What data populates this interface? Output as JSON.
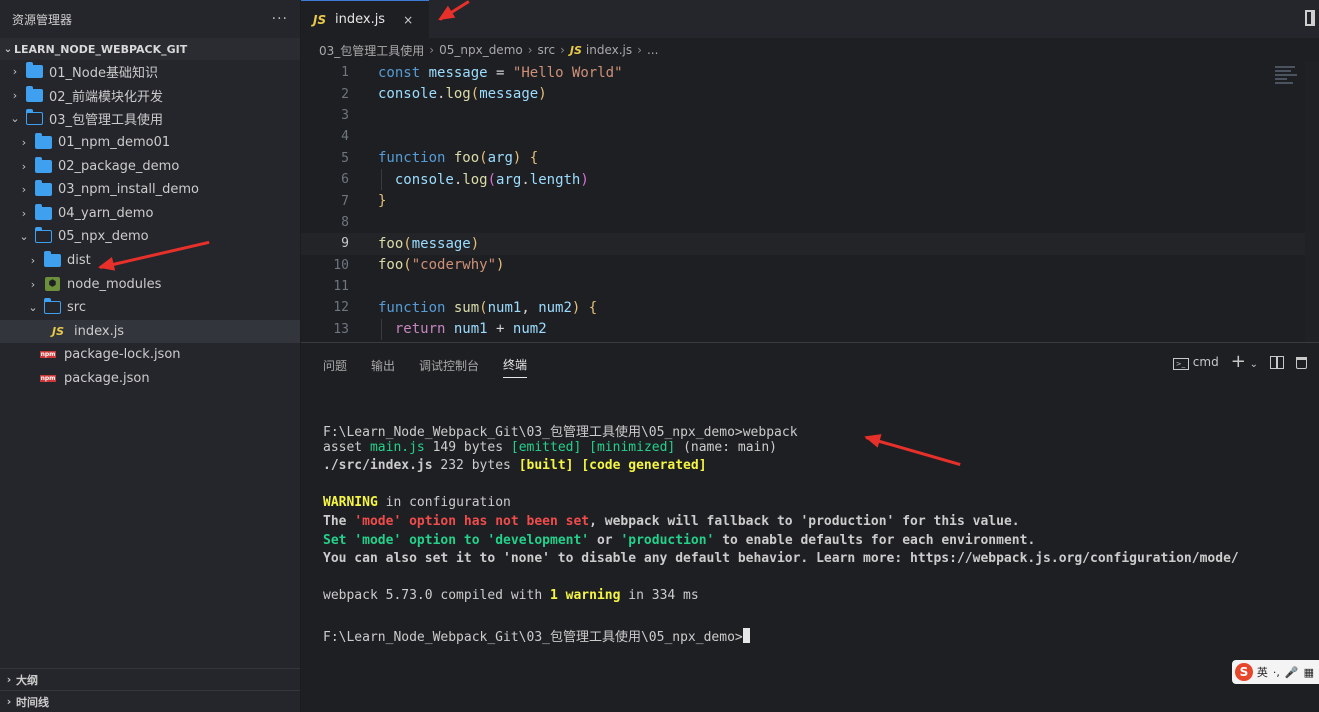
{
  "sidebar": {
    "title": "资源管理器",
    "more": "···",
    "root": "LEARN_NODE_WEBPACK_GIT",
    "items": [
      {
        "label": "01_Node基础知识"
      },
      {
        "label": "02_前端模块化开发"
      },
      {
        "label": "03_包管理工具使用"
      },
      {
        "label": "01_npm_demo01"
      },
      {
        "label": "02_package_demo"
      },
      {
        "label": "03_npm_install_demo"
      },
      {
        "label": "04_yarn_demo"
      },
      {
        "label": "05_npx_demo"
      },
      {
        "label": "dist"
      },
      {
        "label": "node_modules"
      },
      {
        "label": "src"
      },
      {
        "label": "index.js"
      },
      {
        "label": "package-lock.json"
      },
      {
        "label": "package.json"
      }
    ],
    "bottom_sections": [
      "大纲",
      "时间线"
    ]
  },
  "editor": {
    "tab": {
      "icon_text": "JS",
      "label": "index.js",
      "close": "×"
    },
    "breadcrumb": {
      "parts": [
        "03_包管理工具使用",
        "05_npx_demo",
        "src"
      ],
      "file_icon": "JS",
      "file": "index.js",
      "tail": "..."
    },
    "line_numbers": [
      "1",
      "2",
      "3",
      "4",
      "5",
      "6",
      "7",
      "8",
      "9",
      "10",
      "11",
      "12",
      "13"
    ],
    "code": {
      "l1": [
        "const",
        "message",
        "=",
        "\"Hello World\""
      ],
      "l2": [
        "console",
        ".",
        "log",
        "(",
        "message",
        ")"
      ],
      "l5": [
        "function",
        "foo",
        "(",
        "arg",
        ")",
        "{"
      ],
      "l6": [
        "console",
        ".",
        "log",
        "(",
        "arg",
        ".",
        "length",
        ")"
      ],
      "l7": [
        "}"
      ],
      "l9": [
        "foo",
        "(",
        "message",
        ")"
      ],
      "l10": [
        "foo",
        "(",
        "\"coderwhy\"",
        ")"
      ],
      "l12": [
        "function",
        "sum",
        "(",
        "num1",
        ",",
        "num2",
        ")",
        "{"
      ],
      "l13": [
        "return",
        "num1",
        "+",
        "num2"
      ]
    }
  },
  "panel": {
    "tabs": [
      "问题",
      "输出",
      "调试控制台",
      "终端"
    ],
    "shell": "cmd",
    "terminal": {
      "prompt1": "F:\\Learn_Node_Webpack_Git\\03_包管理工具使用\\05_npx_demo>",
      "cmd1": "webpack",
      "asset": "asset",
      "asset_name": "main.js",
      "asset_size": "149 bytes",
      "emitted": "[emitted]",
      "minimized": "[minimized]",
      "asset_tail": "(name: main)",
      "module": "./src/index.js",
      "module_size": "232 bytes",
      "built": "[built]",
      "code_generated": "[code generated]",
      "warn_head": "WARNING",
      "warn_head_tail": "in configuration",
      "w1": [
        "The",
        "'mode'",
        "option has not been set",
        ", webpack will fallback to 'production' for this value."
      ],
      "w2": [
        "Set",
        "'mode'",
        "option to",
        "'development'",
        "or",
        "'production'",
        "to enable defaults for each environment."
      ],
      "w3": "You can also set it to 'none' to disable any default behavior. Learn more: https://webpack.js.org/configuration/mode/",
      "compiled": [
        "webpack 5.73.0 compiled with",
        "1 warning",
        "in 334 ms"
      ],
      "prompt2": "F:\\Learn_Node_Webpack_Git\\03_包管理工具使用\\05_npx_demo>"
    }
  },
  "ime": {
    "logo": "S",
    "lang": "英",
    "punct": "·,",
    "mic": "🎤",
    "grid": "▦"
  }
}
